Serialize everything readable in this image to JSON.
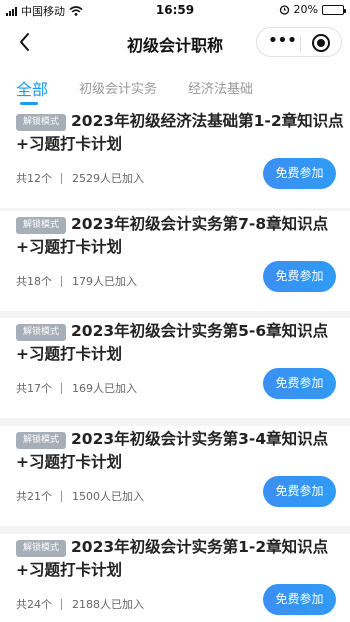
{
  "status_bar": {
    "carrier": "中国移动",
    "time": "16:59",
    "battery_percent": "20%",
    "battery_level": 0.2
  },
  "nav": {
    "title": "初级会计职称"
  },
  "tabs": [
    {
      "label": "全部",
      "active": true
    },
    {
      "label": "初级会计实务",
      "active": false
    },
    {
      "label": "经济法基础",
      "active": false
    }
  ],
  "cards": [
    {
      "badge": "解锁模式",
      "title_line1": "2023年初级经济法基础第1-2章知识点",
      "title_line2": "+习题打卡计划",
      "count": "共12个",
      "joined": "2529人已加入",
      "button": "免费参加"
    },
    {
      "badge": "解锁模式",
      "title_line1": "2023年初级会计实务第7-8章知识点",
      "title_line2": "+习题打卡计划",
      "count": "共18个",
      "joined": "179人已加入",
      "button": "免费参加"
    },
    {
      "badge": "解锁模式",
      "title_line1": "2023年初级会计实务第5-6章知识点",
      "title_line2": "+习题打卡计划",
      "count": "共17个",
      "joined": "169人已加入",
      "button": "免费参加"
    },
    {
      "badge": "解锁模式",
      "title_line1": "2023年初级会计实务第3-4章知识点",
      "title_line2": "+习题打卡计划",
      "count": "共21个",
      "joined": "1500人已加入",
      "button": "免费参加"
    },
    {
      "badge": "解锁模式",
      "title_line1": "2023年初级会计实务第1-2章知识点",
      "title_line2": "+习题打卡计划",
      "count": "共24个",
      "joined": "2188人已加入",
      "button": "免费参加"
    }
  ],
  "icons": {
    "back": "chevron-left-icon",
    "more": "more-dots-icon",
    "close": "target-circle-icon"
  },
  "colors": {
    "accent": "#1e9bf0",
    "button": "#3b8ff3",
    "badge": "#a6aeb7"
  }
}
